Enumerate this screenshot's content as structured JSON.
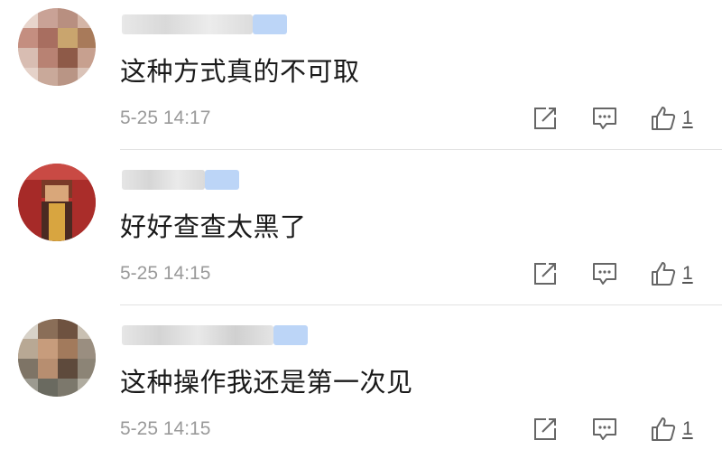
{
  "comments": [
    {
      "text": "这种方式真的不可取",
      "time": "5-25 14:17",
      "likes": "1"
    },
    {
      "text": "好好查查太黑了",
      "time": "5-25 14:15",
      "likes": "1"
    },
    {
      "text": "这种操作我还是第一次见",
      "time": "5-25 14:15",
      "likes": "1"
    }
  ],
  "icons": {
    "share": "share-icon",
    "reply": "comment-icon",
    "like": "thumbs-up-icon"
  },
  "colors": {
    "text": "#1a1a1a",
    "meta": "#9a9a9a",
    "icon": "#666666",
    "divider": "#e2e2e2",
    "verified_blur": "#bcd5f7"
  }
}
